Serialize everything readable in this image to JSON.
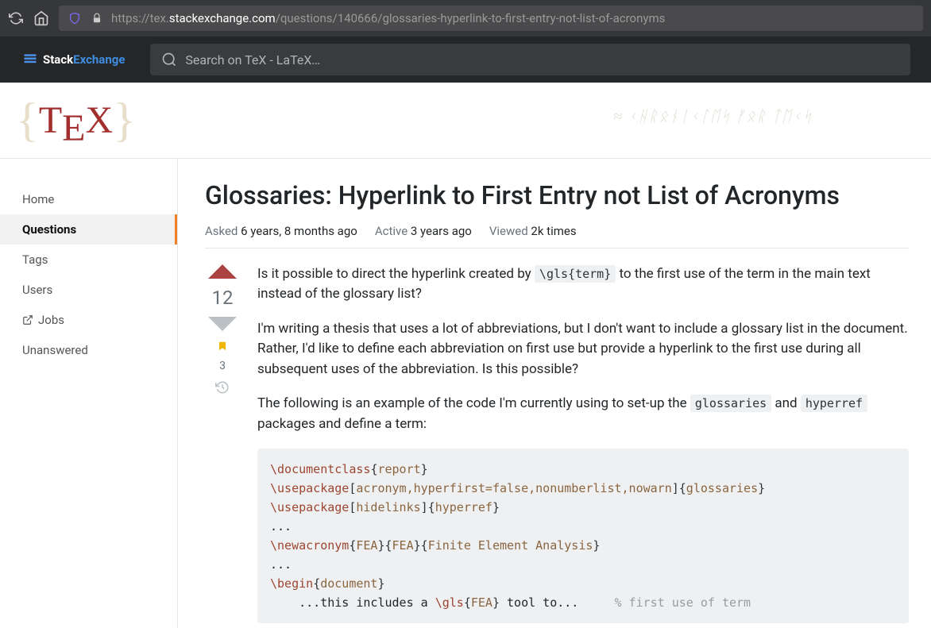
{
  "browser": {
    "url_prefix": "https://tex.",
    "url_host": "stackexchange.com",
    "url_path": "/questions/140666/glossaries-hyperlink-to-first-entry-not-list-of-acronyms"
  },
  "topbar": {
    "logo_stack": "Stack",
    "logo_exchange": "Exchange",
    "search_placeholder": "Search on TeX - LaTeX…"
  },
  "banner": {
    "tex_t": "T",
    "tex_e": "E",
    "tex_x": "X",
    "elvish": "≈ ᚲᚺᚱᛟᚾᛁᚲᛚᛖᛋ ᚠᛟᚱ ᛏᛖᚲᛋ"
  },
  "nav": {
    "home": "Home",
    "questions": "Questions",
    "tags": "Tags",
    "users": "Users",
    "jobs": "Jobs",
    "unanswered": "Unanswered"
  },
  "question": {
    "title": "Glossaries: Hyperlink to First Entry not List of Acronyms",
    "asked_label": "Asked",
    "asked_val": "6 years, 8 months ago",
    "active_label": "Active",
    "active_val": "3 years ago",
    "viewed_label": "Viewed",
    "viewed_val": "2k times",
    "vote_count": "12",
    "bookmark_count": "3",
    "p1_a": "Is it possible to direct the hyperlink created by ",
    "p1_code": "\\gls{term}",
    "p1_b": " to the first use of the term in the main text instead of the glossary list?",
    "p2": "I'm writing a thesis that uses a lot of abbreviations, but I don't want to include a glossary list in the document. Rather, I'd like to define each abbreviation on first use but provide a hyperlink to the first use during all subsequent uses of the abbreviation. Is this possible?",
    "p3_a": "The following is an example of the code I'm currently using to set-up the ",
    "p3_code1": "glossaries",
    "p3_b": " and ",
    "p3_code2": "hyperref",
    "p3_c": " packages and define a term:",
    "code": {
      "l1_cmd": "\\documentclass",
      "l1_arg": "report",
      "l2_cmd": "\\usepackage",
      "l2_opt": "acronym,hyperfirst=false,nonumberlist,nowarn",
      "l2_arg": "glossaries",
      "l3_cmd": "\\usepackage",
      "l3_opt": "hidelinks",
      "l3_arg": "hyperref",
      "l4": "...",
      "l5_cmd": "\\newacronym",
      "l5_a1": "FEA",
      "l5_a2": "FEA",
      "l5_a3": "Finite Element Analysis",
      "l6": "...",
      "l7_cmd": "\\begin",
      "l7_arg": "document",
      "l8_txt": "    ...this includes a ",
      "l8_cmd": "\\gls",
      "l8_arg": "FEA",
      "l8_txt2": " tool to...     ",
      "l8_comment": "% first use of term"
    }
  }
}
